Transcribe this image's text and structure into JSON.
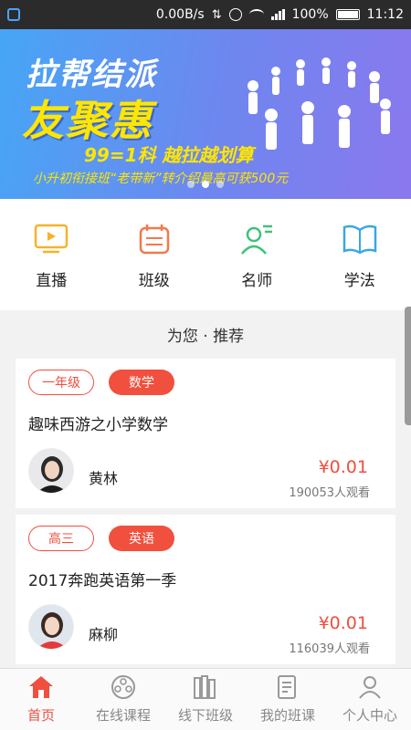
{
  "status_bar": {
    "net_speed": "0.00B/s",
    "battery": "100%",
    "time": "11:12"
  },
  "banner": {
    "title1": "拉帮结派",
    "title2": "友聚惠",
    "line3": "99=1科 越拉越划算",
    "line4": "小升初衔接班“老带新”转介绍最高可获500元",
    "dots": 3,
    "active_dot": 2
  },
  "quick_nav": [
    {
      "label": "直播",
      "icon": "live-tv-icon",
      "color": "#f5b32a"
    },
    {
      "label": "班级",
      "icon": "calendar-class-icon",
      "color": "#f07a4c"
    },
    {
      "label": "名师",
      "icon": "teacher-icon",
      "color": "#3fc27a"
    },
    {
      "label": "学法",
      "icon": "book-icon",
      "color": "#3aa6e6"
    }
  ],
  "section_title": "为您 · 推荐",
  "courses": [
    {
      "grade": "一年级",
      "subject": "数学",
      "title": "趣味西游之小学数学",
      "teacher": "黄林",
      "price": "¥0.01",
      "views": "190053人观看"
    },
    {
      "grade": "高三",
      "subject": "英语",
      "title": "2017奔跑英语第一季",
      "teacher": "麻柳",
      "price": "¥0.01",
      "views": "116039人观看"
    }
  ],
  "bottom_nav": [
    {
      "label": "首页",
      "icon": "home-icon",
      "active": true
    },
    {
      "label": "在线课程",
      "icon": "film-reel-icon",
      "active": false
    },
    {
      "label": "线下班级",
      "icon": "books-icon",
      "active": false
    },
    {
      "label": "我的班课",
      "icon": "document-icon",
      "active": false
    },
    {
      "label": "个人中心",
      "icon": "user-icon",
      "active": false
    }
  ],
  "colors": {
    "accent": "#f04e3e",
    "banner_yellow": "#ffe600"
  }
}
